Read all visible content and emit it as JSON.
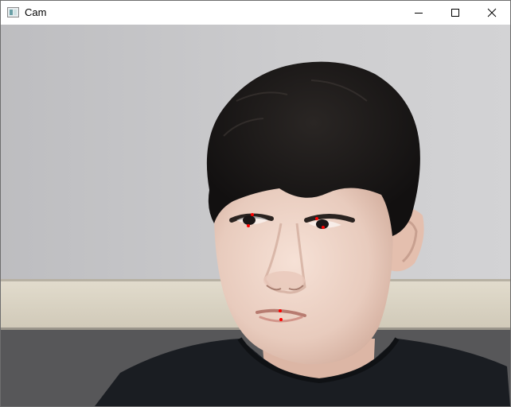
{
  "window": {
    "title": "Cam",
    "icon": "app-window-icon",
    "controls": [
      {
        "name": "minimize-button",
        "icon": "minimize-icon"
      },
      {
        "name": "maximize-button",
        "icon": "maximize-icon"
      },
      {
        "name": "close-button",
        "icon": "close-icon"
      }
    ]
  },
  "camera_feed": {
    "description_icon": "camera-frame",
    "landmarks": [
      {
        "name": "left-eye-top"
      },
      {
        "name": "left-eye-bottom"
      },
      {
        "name": "right-eye-top"
      },
      {
        "name": "right-eye-bottom"
      },
      {
        "name": "mouth-top"
      },
      {
        "name": "mouth-bottom"
      }
    ],
    "landmark_color": "#ff0000"
  }
}
